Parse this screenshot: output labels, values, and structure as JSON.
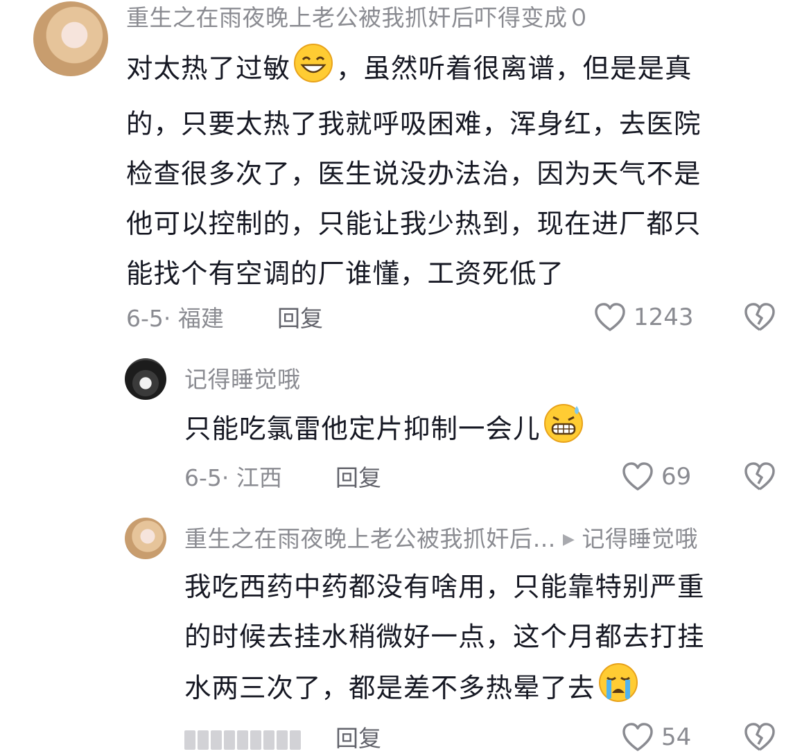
{
  "comments": [
    {
      "author": "重生之在雨夜晚上老公被我抓奸后吓得变成０",
      "lines": [
        "对太热了过敏",
        "，虽然听着很离谱，但是是真",
        "的，只要太热了我就呼吸困难，浑身红，去医院",
        "检查很多次了，医生说没办法治，因为天气不是",
        "他可以控制的，只能让我少热到，现在进厂都只",
        "能找个有空调的厂谁懂，工资死低了"
      ],
      "emoji": "grinning-sweat-emoji",
      "date_location": "6-5· 福建",
      "reply_label": "回复",
      "likes": "1243"
    },
    {
      "author": "记得睡觉哦",
      "text": "只能吃氯雷他定片抑制一会儿",
      "emoji": "grimacing-sweat-emoji",
      "date_location": "6-5· 江西",
      "reply_label": "回复",
      "likes": "69"
    },
    {
      "author": "重生之在雨夜晚上老公被我抓奸后…",
      "reply_to": "记得睡觉哦",
      "lines": [
        "我吃西药中药都没有啥用，只能靠特别严重",
        "的时候去挂水稍微好一点，这个月都去打挂",
        "水两三次了，都是差不多热晕了去"
      ],
      "emoji": "crying-emoji",
      "reply_label": "回复",
      "likes": "54"
    }
  ],
  "colors": {
    "text": "#161823",
    "meta": "#8a8b91",
    "emoji": "#ffcc33"
  }
}
